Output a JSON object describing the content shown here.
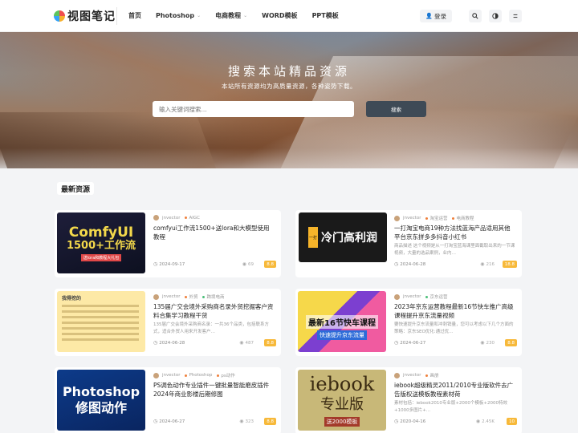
{
  "header": {
    "logo_text": "视图笔记",
    "nav": [
      {
        "label": "首页",
        "dropdown": false
      },
      {
        "label": "Photoshop",
        "dropdown": true
      },
      {
        "label": "电商教程",
        "dropdown": true
      },
      {
        "label": "WORD模板",
        "dropdown": false
      },
      {
        "label": "PPT模板",
        "dropdown": false
      }
    ],
    "login_label": "登录",
    "icons": [
      "search-icon",
      "theme-toggle-icon",
      "menu-icon"
    ]
  },
  "hero": {
    "title": "搜索本站精品资源",
    "subtitle": "本站所有资源均为高质量资源，各种姿势下载。",
    "search_placeholder": "输入关键词搜索...",
    "search_button": "搜索"
  },
  "section_title": "最新资源",
  "cards": [
    {
      "author": "jnvector",
      "tags": [
        {
          "label": "AIGC",
          "color": "#f0803c"
        }
      ],
      "title": "comfyui工作流1500+送lora和大模型使用教程",
      "desc": "",
      "date": "2024-09-17",
      "views": "69",
      "price": "8.8",
      "thumb": {
        "line1": "ComfyUI",
        "line2": "1500+工作流",
        "small": "送lora和教程大礼包"
      }
    },
    {
      "author": "jnvector",
      "tags": [
        {
          "label": "淘宝运营",
          "color": "#f0803c"
        },
        {
          "label": "电商教程",
          "color": "#f0803c"
        }
      ],
      "title": "一打淘宝电商19种方法找蓝海产品适用其他平台京东拼多多抖音小红书",
      "desc": "商品描述 这个视频是从一打淘宝蓝海课里面截取出来的一节课视频，大量的选品案例，业内…",
      "date": "2024-06-28",
      "views": "216",
      "price": "18.8",
      "thumb": {
        "tag": "一打",
        "line1": "冷门高利润"
      }
    },
    {
      "author": "jnvector",
      "tags": [
        {
          "label": "外贸",
          "color": "#f0803c"
        },
        {
          "label": "跨境电商",
          "color": "#4cc07a"
        }
      ],
      "title": "135届广交会境外采购商名录外贸挖掘客户资料合集学习教程干货",
      "desc": "135届广交会境外采购商名录：一共36个品类，包括联系方式，适合外贸人用来开发客户…",
      "date": "2024-06-28",
      "views": "487",
      "price": "8.8",
      "thumb": {
        "line1": "我得挖的"
      }
    },
    {
      "author": "jnvector",
      "tags": [
        {
          "label": "京东运营",
          "color": "#4cc07a"
        }
      ],
      "title": "2023年京东运营教程最新16节快车推广高级课程提升京东流量视频",
      "desc": "要快速提升京东流量和冲刺销量，您可以考虑以下几个方面的策略：京东SEO优化:通过优…",
      "date": "2024-06-27",
      "views": "230",
      "price": "8.8",
      "thumb": {
        "line1": "最新16节快车课程",
        "small": "快速提升京东流量"
      }
    },
    {
      "author": "jnvector",
      "tags": [
        {
          "label": "Photoshop",
          "color": "#f0803c"
        },
        {
          "label": "ps动作",
          "color": "#f0803c"
        }
      ],
      "title": "PS调色动作专业插件一键批量智能磨皮插件2024年商业影楼后期修图",
      "desc": "",
      "date": "2024-06-27",
      "views": "323",
      "price": "8.8",
      "thumb": {
        "line1": "Photoshop",
        "line2": "修图动作"
      }
    },
    {
      "author": "jnvector",
      "tags": [
        {
          "label": "画册",
          "color": "#f0803c"
        }
      ],
      "title": "iebook超级精灵2011/2010专业版软件去广告版权送模板教程素材荷",
      "desc": "素材包括：iebook2010专业版+2000个模板+2000特效+1000多图片+…",
      "date": "2020-04-16",
      "views": "2.45K",
      "price": "10",
      "thumb": {
        "line1": "iebook",
        "line2": "专业版",
        "small": "送2000模板"
      }
    }
  ]
}
